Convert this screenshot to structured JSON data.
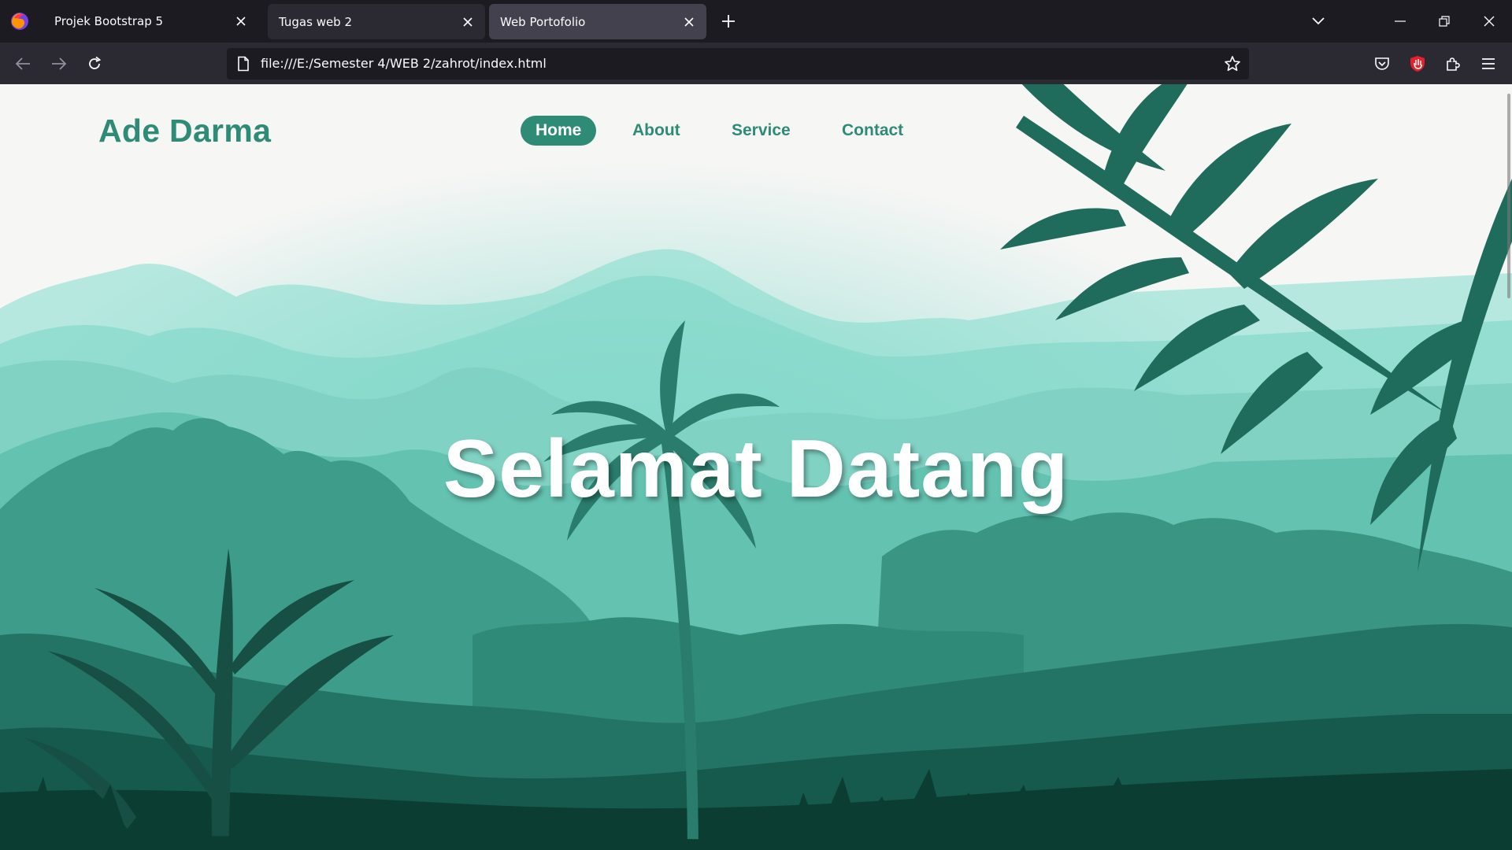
{
  "browser": {
    "tabs": [
      {
        "label": "Projek Bootstrap 5",
        "active": false
      },
      {
        "label": "Tugas web 2",
        "active": false
      },
      {
        "label": "Web Portofolio",
        "active": true
      }
    ],
    "url": "file:///E:/Semester 4/WEB 2/zahrot/index.html",
    "icons": [
      "firefox-logo-icon",
      "close-icon",
      "plus-icon",
      "chevron-down-icon",
      "minimize-icon",
      "restore-icon",
      "back-arrow-icon",
      "forward-arrow-icon",
      "reload-icon",
      "page-icon",
      "star-icon",
      "pocket-icon",
      "extension-red-icon",
      "puzzle-icon",
      "hamburger-menu-icon"
    ]
  },
  "page": {
    "brand": "Ade Darma",
    "nav": [
      {
        "label": "Home",
        "active": true
      },
      {
        "label": "About",
        "active": false
      },
      {
        "label": "Service",
        "active": false
      },
      {
        "label": "Contact",
        "active": false
      }
    ],
    "hero_title": "Selamat Datang"
  },
  "colors": {
    "accent": "#2e8b75",
    "chrome_dark": "#1c1b22",
    "chrome_mid": "#2b2a33",
    "active_tab": "#42414d",
    "forest_dark": "#0b3d33",
    "mist": "#b6e8df"
  }
}
